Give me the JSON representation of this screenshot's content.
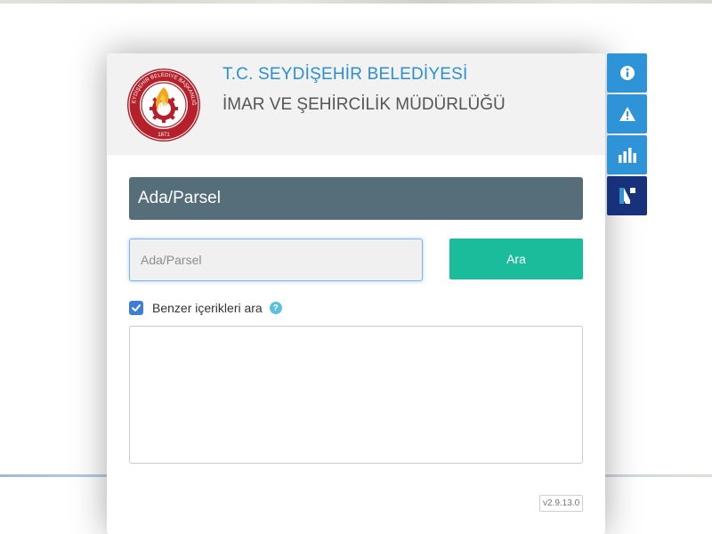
{
  "header": {
    "title": "T.C. SEYDİŞEHİR BELEDİYESİ",
    "subtitle": "İMAR VE ŞEHİRCİLİK MÜDÜRLÜĞÜ",
    "logo": {
      "ring_text": "SEYDİŞEHİR BELEDİYE BAŞKANLIĞI",
      "year": "1871"
    }
  },
  "search": {
    "section_title": "Ada/Parsel",
    "placeholder": "Ada/Parsel",
    "value": "",
    "button_label": "Ara"
  },
  "options": {
    "similar_label": "Benzer içerikleri ara",
    "similar_checked": true,
    "help_symbol": "?"
  },
  "footer": {
    "version": "v2.9.13.0"
  },
  "toolbar": {
    "items": [
      {
        "icon": "info-icon"
      },
      {
        "icon": "warning-icon"
      },
      {
        "icon": "bar-chart-icon"
      },
      {
        "icon": "brand-logo-icon"
      }
    ]
  },
  "colors": {
    "title": "#2b8fd0",
    "section_bar": "#566e79",
    "search_button": "#1abc9c",
    "checkbox": "#3b7dd8",
    "toolbar_blue": "#2f93d8",
    "toolbar_navy": "#17327a"
  }
}
